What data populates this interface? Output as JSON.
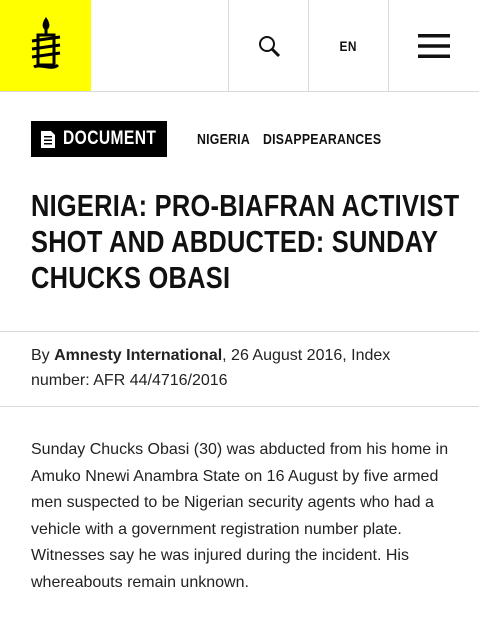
{
  "header": {
    "logo_name": "amnesty-candle-logo",
    "search_icon": "search-icon",
    "language": "EN",
    "menu_icon": "hamburger-menu-icon"
  },
  "tags": {
    "document_badge": "DOCUMENT",
    "document_icon": "document-icon",
    "topics": [
      "NIGERIA",
      "DISAPPEARANCES"
    ]
  },
  "article": {
    "title": "NIGERIA: PRO-BIAFRAN ACTIVIST SHOT AND ABDUCTED: SUNDAY CHUCKS OBASI",
    "byline_prefix": "By ",
    "author": "Amnesty International",
    "byline_suffix": ", 26 August 2016, Index number: AFR 44/4716/2016",
    "body": "Sunday Chucks Obasi (30) was abducted from his home in Amuko Nnewi Anambra State on 16 August by five armed men suspected to be Nigerian security agents who had a vehicle with a government registration number plate. Witnesses say he was injured during the incident. His whereabouts remain unknown."
  },
  "colors": {
    "brand_yellow": "#ffff00",
    "badge_black": "#000000",
    "divider": "#d9d9d9"
  }
}
